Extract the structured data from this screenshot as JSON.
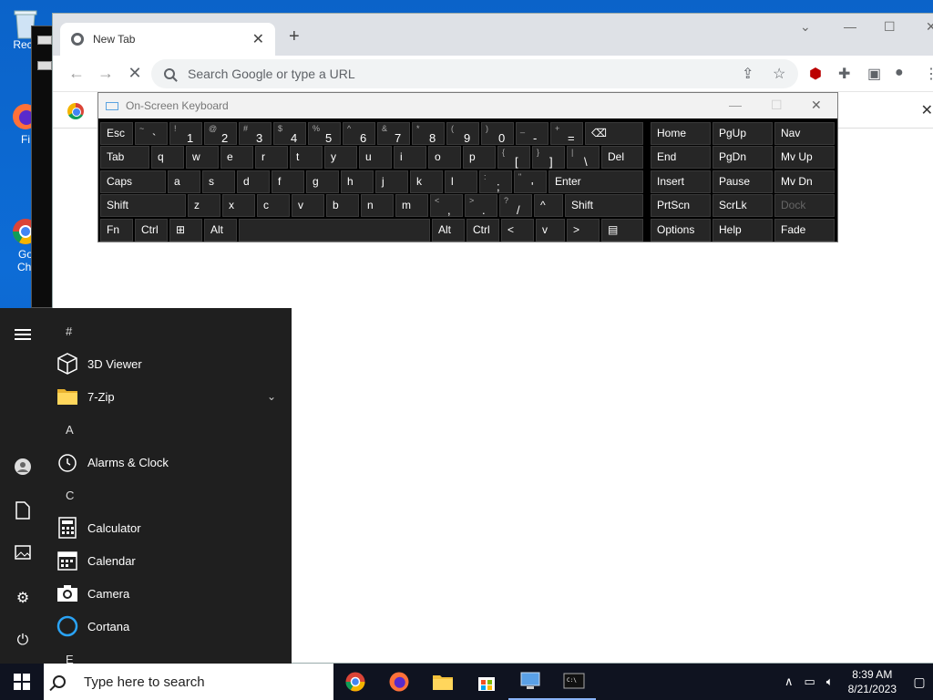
{
  "desktop": {
    "icons": [
      {
        "label": "Recy",
        "icon": "recycle-bin-icon"
      },
      {
        "label": "Fi",
        "icon": "firefox-icon"
      },
      {
        "label": "Go\nChi",
        "icon": "chrome-icon"
      }
    ]
  },
  "browser": {
    "tab_title": "New Tab",
    "omnibox_placeholder": "Search Google or type a URL",
    "accent": "#dee1e6"
  },
  "osk": {
    "title": "On-Screen Keyboard",
    "rows": [
      [
        {
          "main": "Esc"
        },
        {
          "shift": "~",
          "ch": "`"
        },
        {
          "shift": "!",
          "ch": "1"
        },
        {
          "shift": "@",
          "ch": "2"
        },
        {
          "shift": "#",
          "ch": "3"
        },
        {
          "shift": "$",
          "ch": "4"
        },
        {
          "shift": "%",
          "ch": "5"
        },
        {
          "shift": "^",
          "ch": "6"
        },
        {
          "shift": "&",
          "ch": "7"
        },
        {
          "shift": "*",
          "ch": "8"
        },
        {
          "shift": "(",
          "ch": "9"
        },
        {
          "shift": ")",
          "ch": "0"
        },
        {
          "shift": "_",
          "ch": "-"
        },
        {
          "shift": "+",
          "ch": "="
        },
        {
          "main": "⌫"
        }
      ],
      [
        {
          "main": "Tab"
        },
        {
          "main": "q"
        },
        {
          "main": "w"
        },
        {
          "main": "e"
        },
        {
          "main": "r"
        },
        {
          "main": "t"
        },
        {
          "main": "y"
        },
        {
          "main": "u"
        },
        {
          "main": "i"
        },
        {
          "main": "o"
        },
        {
          "main": "p"
        },
        {
          "shift": "{",
          "ch": "["
        },
        {
          "shift": "}",
          "ch": "]"
        },
        {
          "shift": "|",
          "ch": "\\"
        },
        {
          "main": "Del"
        }
      ],
      [
        {
          "main": "Caps"
        },
        {
          "main": "a"
        },
        {
          "main": "s"
        },
        {
          "main": "d"
        },
        {
          "main": "f"
        },
        {
          "main": "g"
        },
        {
          "main": "h"
        },
        {
          "main": "j"
        },
        {
          "main": "k"
        },
        {
          "main": "l"
        },
        {
          "shift": ":",
          "ch": ";"
        },
        {
          "shift": "\"",
          "ch": "'"
        },
        {
          "main": "Enter"
        }
      ],
      [
        {
          "main": "Shift"
        },
        {
          "main": "z"
        },
        {
          "main": "x"
        },
        {
          "main": "c"
        },
        {
          "main": "v"
        },
        {
          "main": "b"
        },
        {
          "main": "n"
        },
        {
          "main": "m"
        },
        {
          "shift": "<",
          "ch": ","
        },
        {
          "shift": ">",
          "ch": "."
        },
        {
          "shift": "?",
          "ch": "/"
        },
        {
          "main": "^"
        },
        {
          "main": "Shift"
        }
      ],
      [
        {
          "main": "Fn"
        },
        {
          "main": "Ctrl"
        },
        {
          "main": "⊞"
        },
        {
          "main": "Alt"
        },
        {
          "main": ""
        },
        {
          "main": "Alt"
        },
        {
          "main": "Ctrl"
        },
        {
          "main": "<"
        },
        {
          "main": "v"
        },
        {
          "main": ">"
        },
        {
          "main": "▤"
        }
      ]
    ],
    "side_keys": [
      [
        "Home",
        "PgUp",
        "Nav"
      ],
      [
        "End",
        "PgDn",
        "Mv Up"
      ],
      [
        "Insert",
        "Pause",
        "Mv Dn"
      ],
      [
        "PrtScn",
        "ScrLk",
        "Dock"
      ],
      [
        "Options",
        "Help",
        "Fade"
      ]
    ]
  },
  "start_menu": {
    "entries": [
      {
        "type": "letter",
        "text": "#"
      },
      {
        "type": "app",
        "text": "3D Viewer",
        "icon": "cube-icon"
      },
      {
        "type": "app",
        "text": "7-Zip",
        "icon": "folder-icon",
        "expand": true
      },
      {
        "type": "letter",
        "text": "A"
      },
      {
        "type": "app",
        "text": "Alarms & Clock",
        "icon": "clock-icon"
      },
      {
        "type": "letter",
        "text": "C"
      },
      {
        "type": "app",
        "text": "Calculator",
        "icon": "calculator-icon"
      },
      {
        "type": "app",
        "text": "Calendar",
        "icon": "calendar-icon"
      },
      {
        "type": "app",
        "text": "Camera",
        "icon": "camera-icon"
      },
      {
        "type": "app",
        "text": "Cortana",
        "icon": "cortana-icon"
      },
      {
        "type": "letter",
        "text": "E"
      }
    ]
  },
  "taskbar": {
    "search_placeholder": "Type here to search",
    "time": "8:39 AM",
    "date": "8/21/2023",
    "apps": [
      "chrome-icon",
      "firefox-icon",
      "file-explorer-icon",
      "store-icon",
      "network-app-icon",
      "terminal-icon"
    ]
  }
}
